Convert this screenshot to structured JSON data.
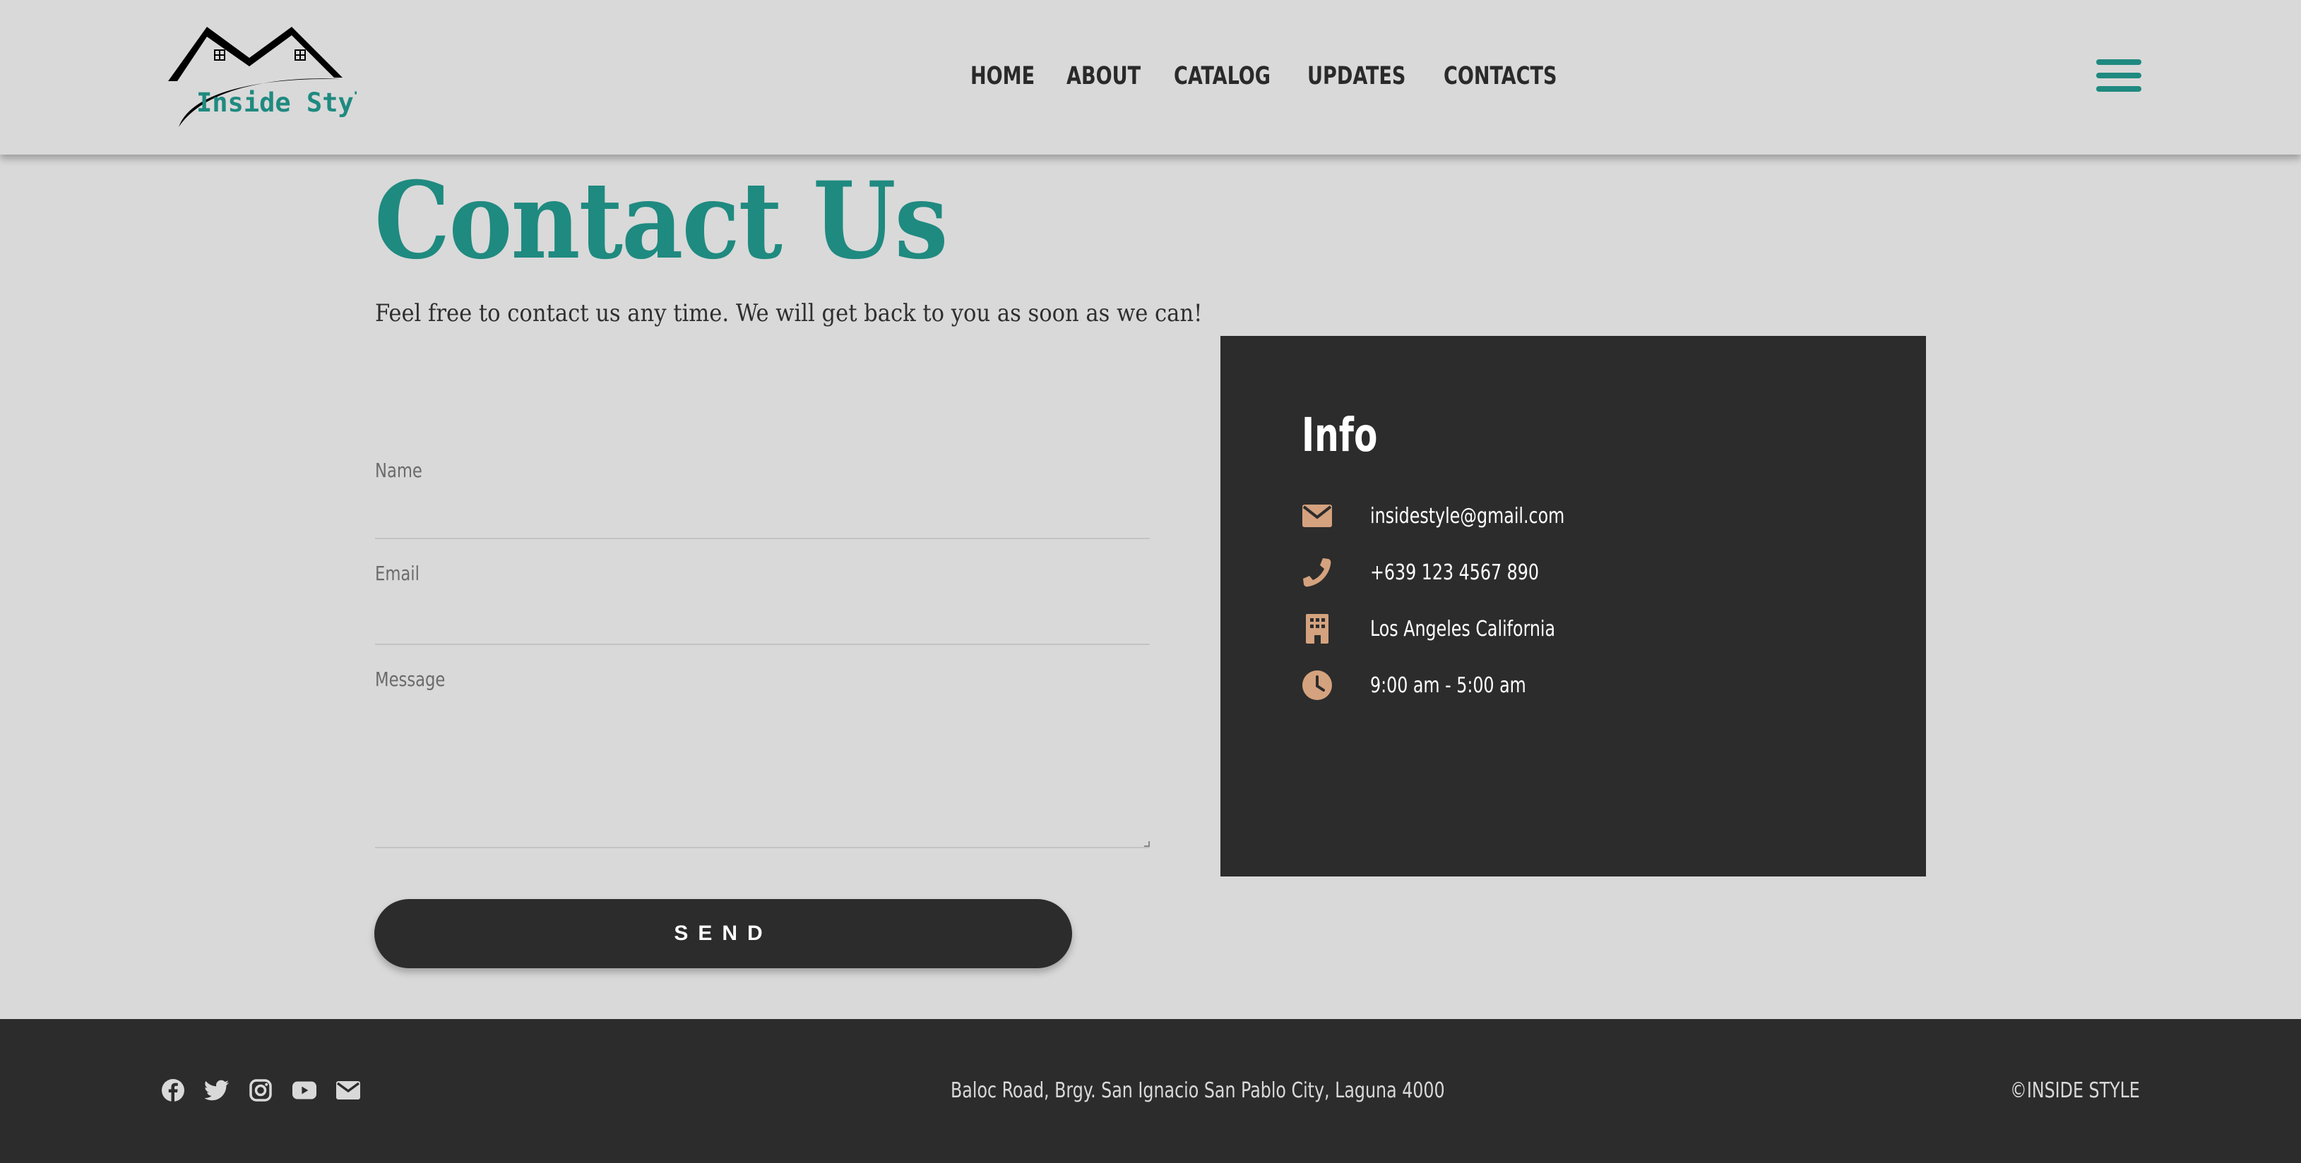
{
  "header": {
    "logo_text": "Inside Style",
    "nav": [
      "HOME",
      "ABOUT",
      "CATALOG",
      "UPDATES",
      "CONTACTS"
    ],
    "menu_icon": "hamburger-menu-icon"
  },
  "main": {
    "title": "Contact Us",
    "subtitle": "Feel free to contact us any time. We will get back to you as soon as we can!",
    "form": {
      "name_label": "Name",
      "email_label": "Email",
      "message_label": "Message",
      "send_label": "SEND"
    },
    "info": {
      "heading": "Info",
      "items": [
        {
          "icon": "envelope-icon",
          "text": "insidestyle@gmail.com"
        },
        {
          "icon": "phone-icon",
          "text": "+639 123 4567 890"
        },
        {
          "icon": "building-icon",
          "text": "Los Angeles California"
        },
        {
          "icon": "clock-icon",
          "text": "9:00 am - 5:00 am"
        }
      ]
    }
  },
  "footer": {
    "socials": [
      "facebook-icon",
      "twitter-icon",
      "instagram-icon",
      "youtube-icon",
      "envelope-icon"
    ],
    "address": "Baloc Road, Brgy. San Ignacio San Pablo City, Laguna 4000",
    "copyright": "©INSIDE STYLE"
  },
  "colors": {
    "accent": "#1f8a80",
    "dark": "#2c2c2c",
    "page_bg": "#d9d9d9",
    "icon_tan": "#d4a27e"
  }
}
